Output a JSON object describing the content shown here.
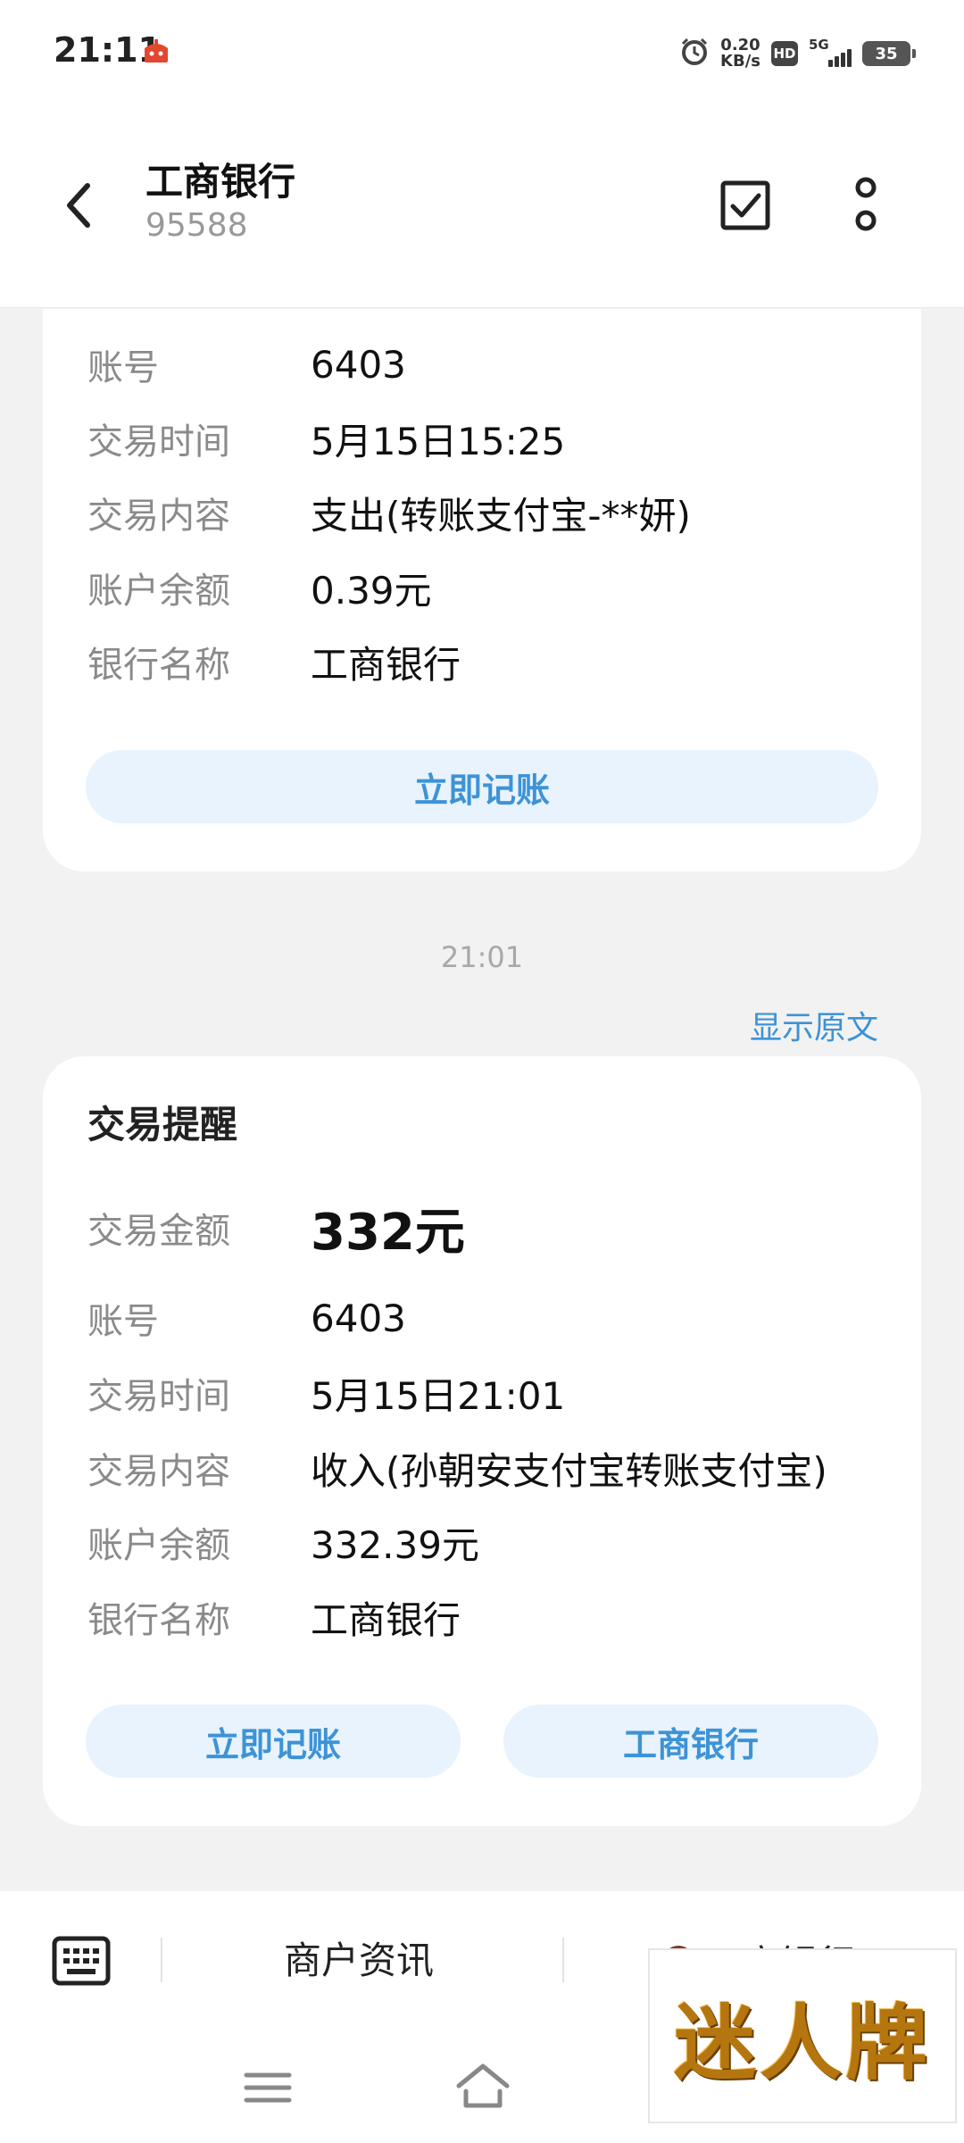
{
  "status_bar": {
    "time": "21:11",
    "net_speed_value": "0.20",
    "net_speed_unit": "KB/s",
    "hd_label": "HD",
    "network_label": "5G",
    "battery_level": "35"
  },
  "header": {
    "title": "工商银行",
    "subtitle": "95588"
  },
  "card1": {
    "rows": [
      {
        "label": "账号",
        "value": "6403"
      },
      {
        "label": "交易时间",
        "value": "5月15日15:25"
      },
      {
        "label": "交易内容",
        "value": "支出(转账支付宝-**妍)"
      },
      {
        "label": "账户余额",
        "value": "0.39元"
      },
      {
        "label": "银行名称",
        "value": "工商银行"
      }
    ],
    "button_label": "立即记账"
  },
  "timestamp": "21:01",
  "show_original_label": "显示原文",
  "card2": {
    "title": "交易提醒",
    "amount_label": "交易金额",
    "amount_value": "332元",
    "rows": [
      {
        "label": "账号",
        "value": "6403"
      },
      {
        "label": "交易时间",
        "value": "5月15日21:01"
      },
      {
        "label": "交易内容",
        "value": "收入(孙朝安支付宝转账支付宝)"
      },
      {
        "label": "账户余额",
        "value": "332.39元"
      },
      {
        "label": "银行名称",
        "value": "工商银行"
      }
    ],
    "button_left_label": "立即记账",
    "button_right_label": "工商银行"
  },
  "bottom_menu": {
    "item1": "商户资讯",
    "item2": "工商银行"
  },
  "watermark": "迷人牌",
  "colors": {
    "accent": "#3d93d6",
    "button_bg": "#e8f3fd",
    "page_bg": "#f2f2f2"
  }
}
